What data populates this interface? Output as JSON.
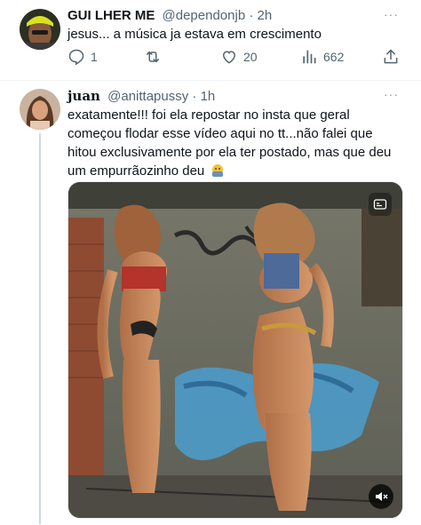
{
  "tweet1": {
    "display_name": "GUI LHER ME",
    "handle": "@dependonjb",
    "separator": "·",
    "time": "2h",
    "text": "jesus... a música ja estava em crescimento",
    "reply_count": "1",
    "like_count": "20",
    "view_count": "662",
    "more_label": "···"
  },
  "tweet2": {
    "display_name": "𝐣𝐮𝐚𝐧",
    "handle": "@anittapussy",
    "separator": "·",
    "time": "1h",
    "text": "exatamente!!! foi ela repostar no insta que geral começou flodar esse vídeo aqui no tt...não falei que hitou exclusivamente por ela ter postado, mas que deu um empurrãozinho deu",
    "emoji": "face-with-hand-over-mouth",
    "more_label": "···"
  },
  "colors": {
    "text_primary": "#0f1419",
    "text_secondary": "#536471",
    "thread_line": "#cfd9de"
  },
  "icons": {
    "reply": "reply-icon",
    "retweet": "retweet-icon",
    "like": "heart-icon",
    "views": "views-icon",
    "share": "share-icon",
    "gif_badge": "gif-badge-icon",
    "mute": "mute-icon"
  }
}
